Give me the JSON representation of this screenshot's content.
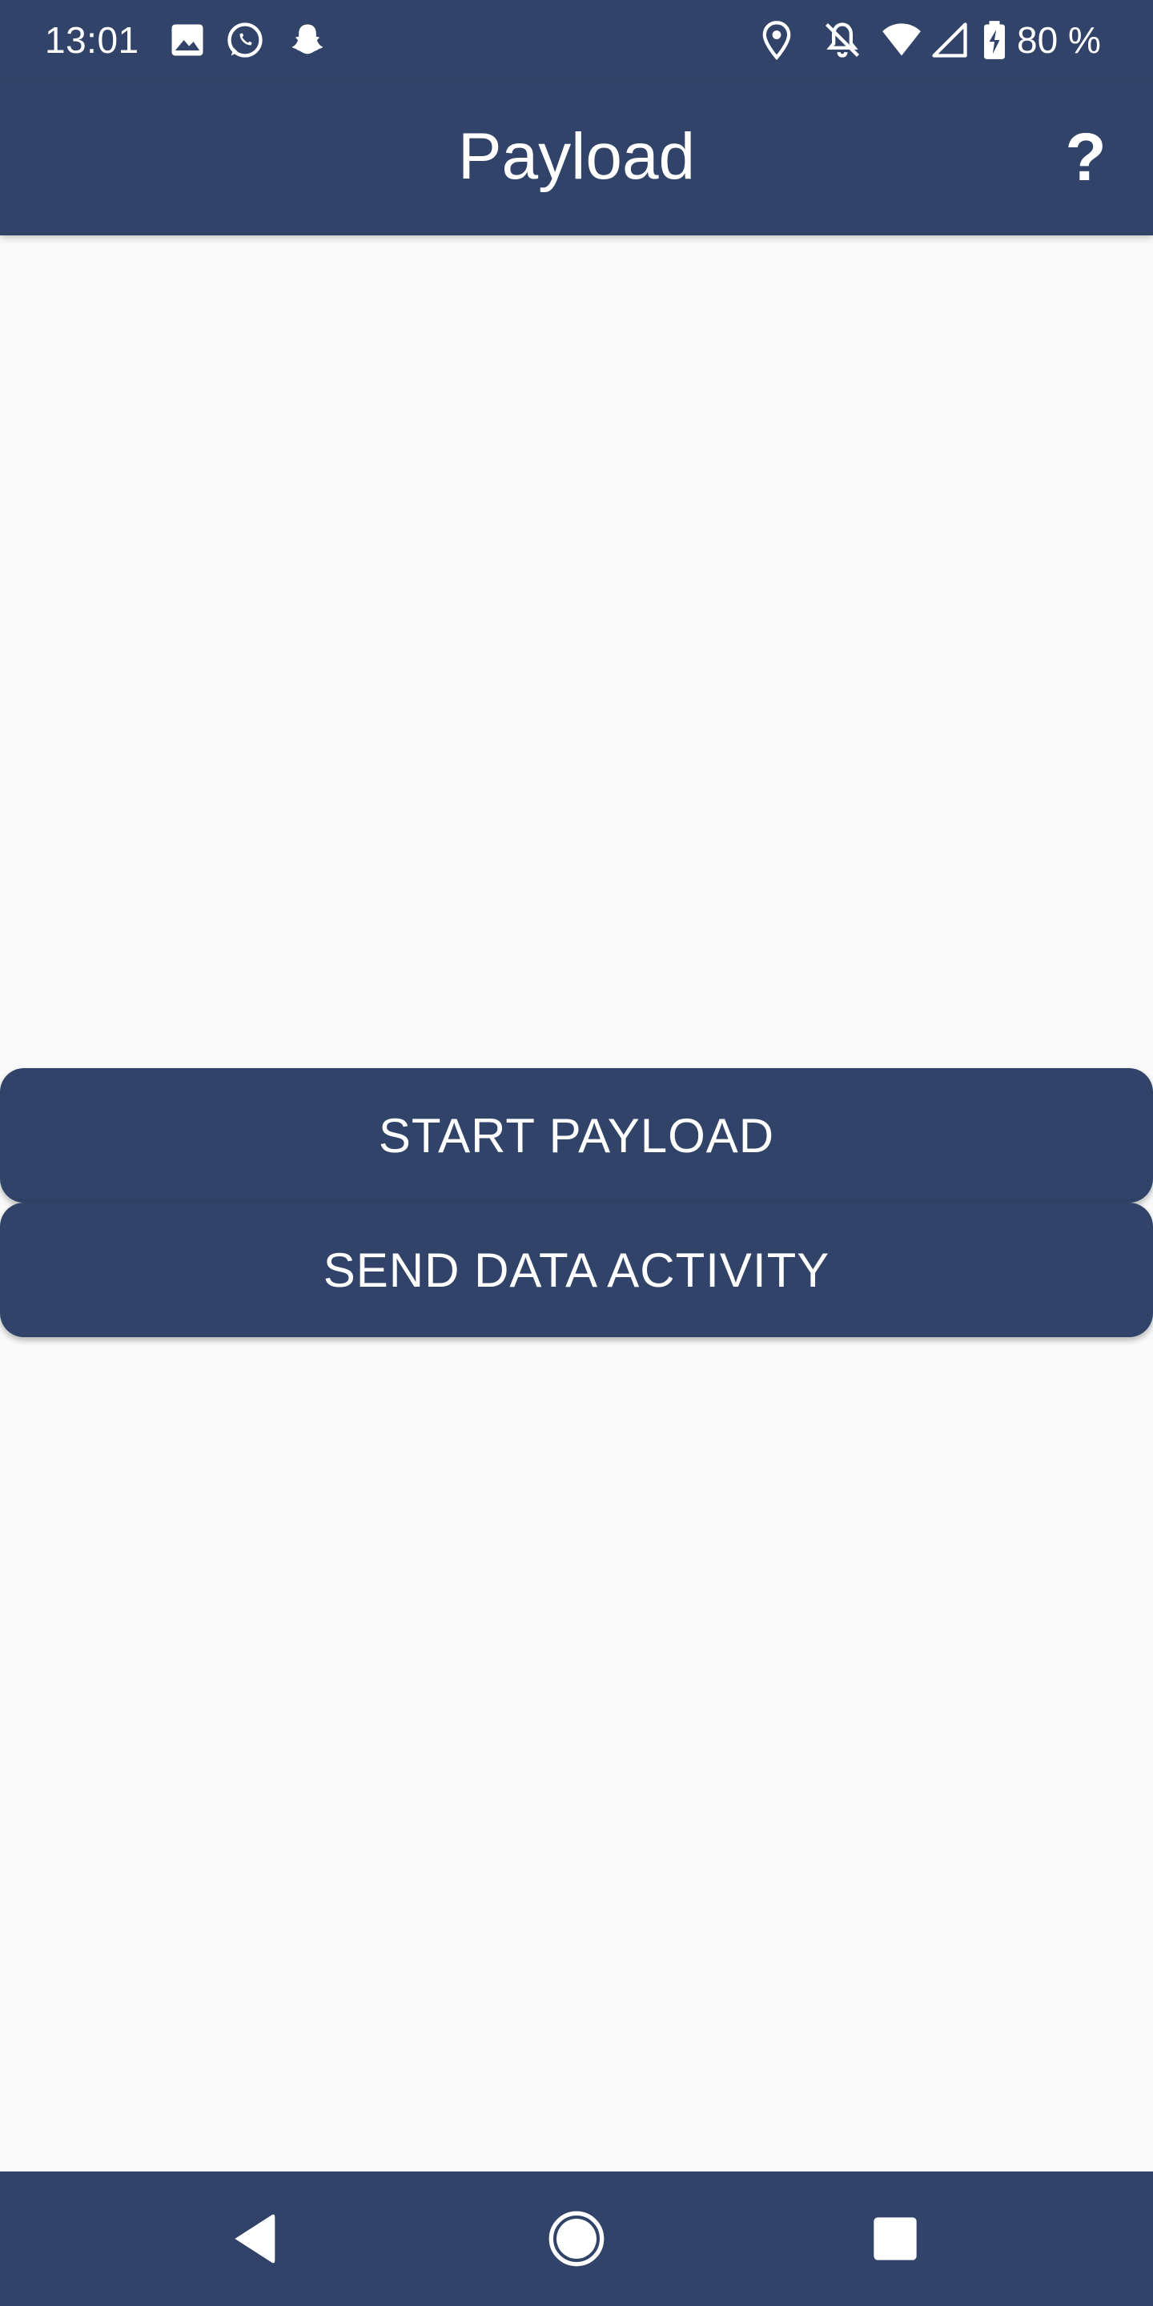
{
  "status_bar": {
    "time": "13:01",
    "left_icons": [
      "image-icon",
      "whatsapp-icon",
      "snapchat-icon"
    ],
    "right_icons": [
      "location-icon",
      "notifications-off-icon",
      "wifi-icon",
      "cellular-signal-icon",
      "battery-charging-icon"
    ],
    "battery": "80 %"
  },
  "app_bar": {
    "title": "Payload",
    "help_label": "?"
  },
  "buttons": {
    "start_payload": "START PAYLOAD",
    "send_data_activity": "SEND DATA ACTIVITY"
  },
  "nav_bar": {
    "items": [
      "back-icon",
      "home-icon",
      "recents-icon"
    ]
  },
  "colors": {
    "primary": "#314368",
    "background": "#FAFAFA",
    "on_primary": "#FFFFFF"
  }
}
